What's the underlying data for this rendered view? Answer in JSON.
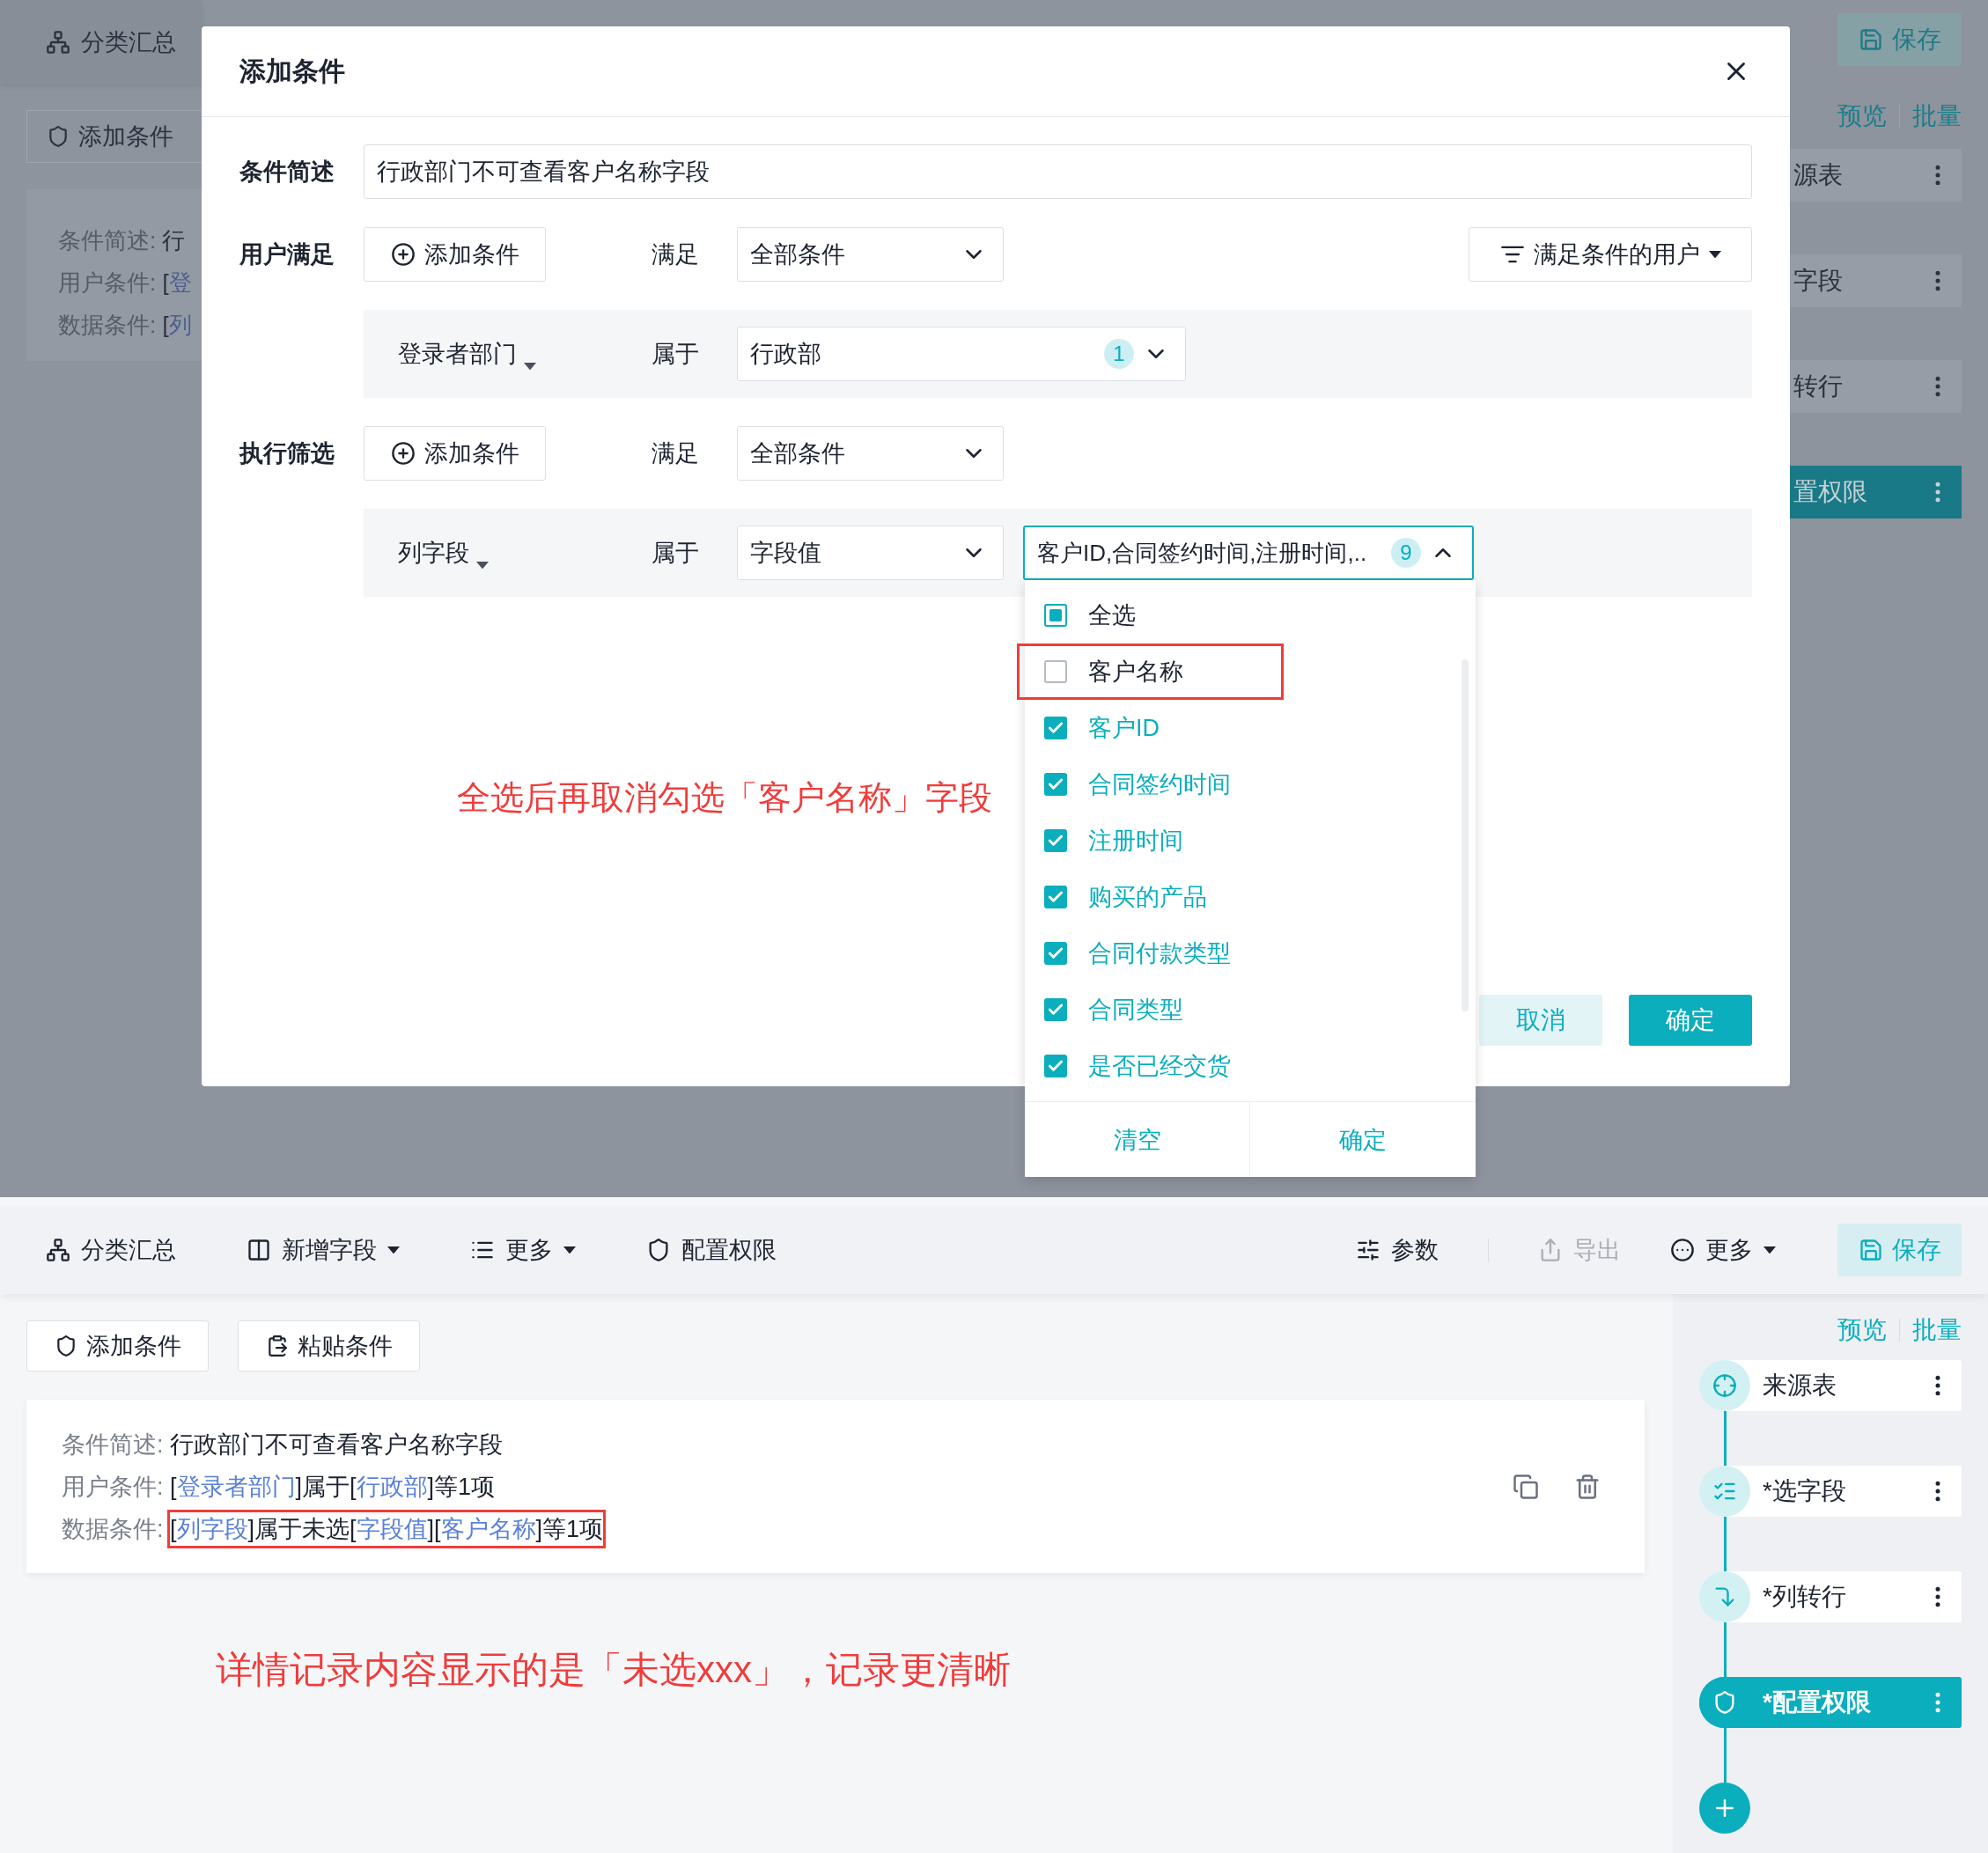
{
  "top_screen": {
    "toolbar": {
      "items": [
        {
          "label": "分类汇总"
        }
      ],
      "save_button": "保存"
    },
    "add_condition_button": "添加条件",
    "summary_lines": [
      {
        "label": "条件简述:",
        "segments": [
          {
            "kind": "plain",
            "text": "行"
          }
        ]
      },
      {
        "label": "用户条件:",
        "segments": [
          {
            "kind": "plain",
            "text": "["
          },
          {
            "kind": "link",
            "text": "登"
          }
        ]
      },
      {
        "label": "数据条件:",
        "segments": [
          {
            "kind": "plain",
            "text": "["
          },
          {
            "kind": "link",
            "text": "列"
          }
        ]
      }
    ],
    "panel_links": [
      "预览",
      "批量"
    ],
    "nodes": [
      {
        "label": "源表",
        "selected": false
      },
      {
        "label": "字段",
        "selected": false
      },
      {
        "label": "转行",
        "selected": false
      },
      {
        "label": "置权限",
        "selected": true
      }
    ],
    "annotation": "全选后再取消勾选「客户名称」字段"
  },
  "dialog": {
    "title": "添加条件",
    "description": {
      "label": "条件简述",
      "value": "行政部门不可查看客户名称字段"
    },
    "user_condition": {
      "label": "用户满足",
      "add_button": "添加条件",
      "match_label": "满足",
      "match_value": "全部条件",
      "user_filter_button": "满足条件的用户",
      "rule": {
        "field": "登录者部门",
        "operator": "属于",
        "value": "行政部",
        "count": "1"
      }
    },
    "filter_condition": {
      "label": "执行筛选",
      "add_button": "添加条件",
      "match_label": "满足",
      "match_value": "全部条件",
      "rule": {
        "field": "列字段",
        "operator": "属于",
        "value_type": "字段值",
        "value": "客户ID,合同签约时间,注册时间,..",
        "count": "9",
        "expanded": true,
        "select_all": {
          "label": "全选",
          "checked": false,
          "indeterminate": true
        },
        "options": [
          {
            "label": "客户名称",
            "checked": false,
            "highlighted": true
          },
          {
            "label": "客户ID",
            "checked": true,
            "highlighted": false
          },
          {
            "label": "合同签约时间",
            "checked": true,
            "highlighted": false
          },
          {
            "label": "注册时间",
            "checked": true,
            "highlighted": false
          },
          {
            "label": "购买的产品",
            "checked": true,
            "highlighted": false
          },
          {
            "label": "合同付款类型",
            "checked": true,
            "highlighted": false
          },
          {
            "label": "合同类型",
            "checked": true,
            "highlighted": false
          },
          {
            "label": "是否已经交货",
            "checked": true,
            "highlighted": false
          }
        ],
        "clear_button": "清空",
        "confirm_button": "确定"
      }
    },
    "cancel_button": "取消",
    "ok_button": "确定"
  },
  "bottom_screen": {
    "toolbar": {
      "left_items": [
        {
          "label": "分类汇总",
          "dropdown": false,
          "disabled": false
        },
        {
          "label": "新增字段",
          "dropdown": true,
          "disabled": false
        },
        {
          "label": "更多",
          "dropdown": true,
          "disabled": false
        },
        {
          "label": "配置权限",
          "dropdown": false,
          "disabled": false
        }
      ],
      "right_items": [
        {
          "label": "参数",
          "dropdown": false,
          "disabled": false
        },
        {
          "label": "导出",
          "dropdown": false,
          "disabled": true
        },
        {
          "label": "更多",
          "dropdown": true,
          "disabled": false
        }
      ],
      "save_button": "保存"
    },
    "condition_buttons": [
      "添加条件",
      "粘贴条件"
    ],
    "condition_lines": [
      {
        "label": "条件简述:",
        "highlighted": false,
        "segments": [
          {
            "kind": "plain",
            "text": "行政部门不可查看客户名称字段"
          }
        ]
      },
      {
        "label": "用户条件:",
        "highlighted": false,
        "segments": [
          {
            "kind": "plain",
            "text": "["
          },
          {
            "kind": "link",
            "text": "登录者部门"
          },
          {
            "kind": "plain",
            "text": "]属于["
          },
          {
            "kind": "link",
            "text": "行政部"
          },
          {
            "kind": "plain",
            "text": "]等1项"
          }
        ]
      },
      {
        "label": "数据条件:",
        "highlighted": true,
        "segments": [
          {
            "kind": "plain",
            "text": "["
          },
          {
            "kind": "link",
            "text": "列字段"
          },
          {
            "kind": "plain",
            "text": "]属于未选["
          },
          {
            "kind": "link",
            "text": "字段值"
          },
          {
            "kind": "plain",
            "text": "]["
          },
          {
            "kind": "link",
            "text": "客户名称"
          },
          {
            "kind": "plain",
            "text": "]等1项"
          }
        ]
      }
    ],
    "panel_links": [
      "预览",
      "批量"
    ],
    "nodes": [
      {
        "label": "来源表",
        "selected": false
      },
      {
        "label": "*选字段",
        "selected": false
      },
      {
        "label": "*列转行",
        "selected": false
      },
      {
        "label": "*配置权限",
        "selected": true
      }
    ],
    "annotation": "详情记录内容显示的是「未选xxx」，记录更清晰"
  }
}
